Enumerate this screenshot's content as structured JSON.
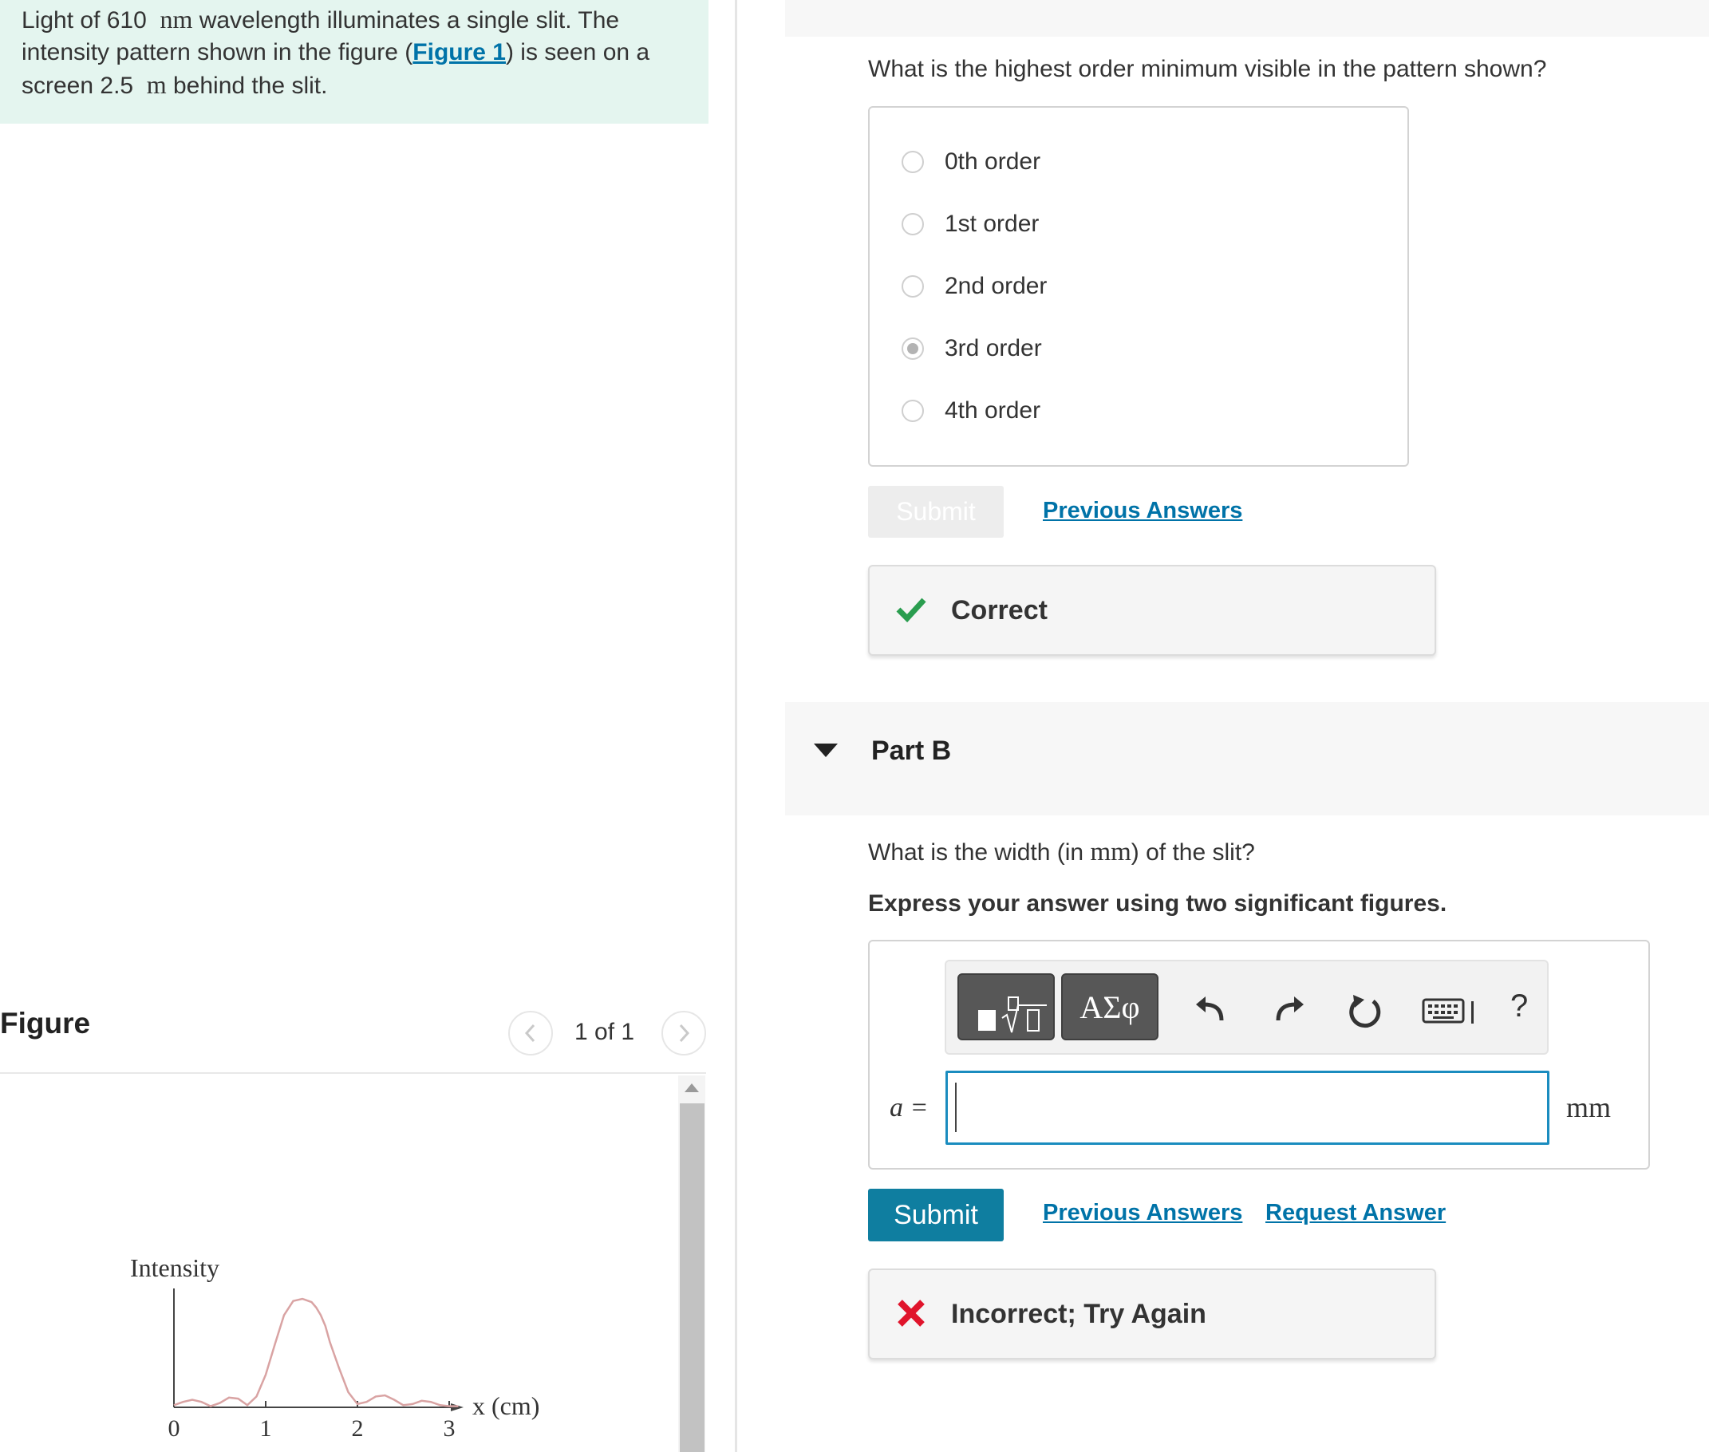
{
  "problem": {
    "text_1": "Light of 610",
    "unit_nm": "nm",
    "text_2": " wavelength illuminates a single slit. The intensity pattern shown in the figure (",
    "figure_link": "Figure 1",
    "text_3": ") is seen on a screen 2.5",
    "unit_m": "m",
    "text_4": " behind the slit."
  },
  "figure": {
    "title": "Figure",
    "page_count": "1 of 1"
  },
  "part_a": {
    "question": "What is the highest order minimum visible in the pattern shown?",
    "options": [
      {
        "label": "0th order",
        "selected": false
      },
      {
        "label": "1st order",
        "selected": false
      },
      {
        "label": "2nd order",
        "selected": false
      },
      {
        "label": "3rd order",
        "selected": true
      },
      {
        "label": "4th order",
        "selected": false
      }
    ],
    "submit_label": "Submit",
    "previous_answers": "Previous Answers",
    "feedback": "Correct"
  },
  "part_b": {
    "title": "Part B",
    "question_1": "What is the width (in ",
    "question_unit": "mm",
    "question_2": ") of the slit?",
    "instruction": "Express your answer using two significant figures.",
    "symbols_label": "ΑΣφ",
    "help_label": "?",
    "variable_label": "a =",
    "answer_value": "",
    "unit": "mm",
    "submit_label": "Submit",
    "previous_answers": "Previous Answers",
    "request_answer": "Request Answer",
    "feedback": "Incorrect; Try Again"
  },
  "chart_data": {
    "type": "line",
    "ylabel": "Intensity",
    "xlabel": "x (cm)",
    "x_ticks": [
      "0",
      "1",
      "2",
      "3"
    ],
    "xlim": [
      0,
      3.1
    ],
    "ylim": [
      0,
      1
    ],
    "series": [
      {
        "x": [
          0.0,
          0.1,
          0.2,
          0.3,
          0.4,
          0.5,
          0.6,
          0.7,
          0.8,
          0.9,
          1.0,
          1.1,
          1.2,
          1.3,
          1.4,
          1.5,
          1.55,
          1.6,
          1.65,
          1.7,
          1.8,
          1.9,
          2.0,
          2.1,
          2.2,
          2.3,
          2.4,
          2.5,
          2.6,
          2.7,
          2.8,
          2.9,
          3.0,
          3.1
        ],
        "y": [
          0.02,
          0.05,
          0.07,
          0.05,
          0.01,
          0.04,
          0.09,
          0.08,
          0.02,
          0.1,
          0.3,
          0.58,
          0.85,
          0.98,
          1.0,
          0.97,
          0.92,
          0.85,
          0.75,
          0.6,
          0.36,
          0.14,
          0.03,
          0.05,
          0.1,
          0.11,
          0.07,
          0.02,
          0.03,
          0.06,
          0.05,
          0.02,
          0.01,
          0.01
        ],
        "color": "#d9a3a3"
      }
    ],
    "grid": false
  }
}
